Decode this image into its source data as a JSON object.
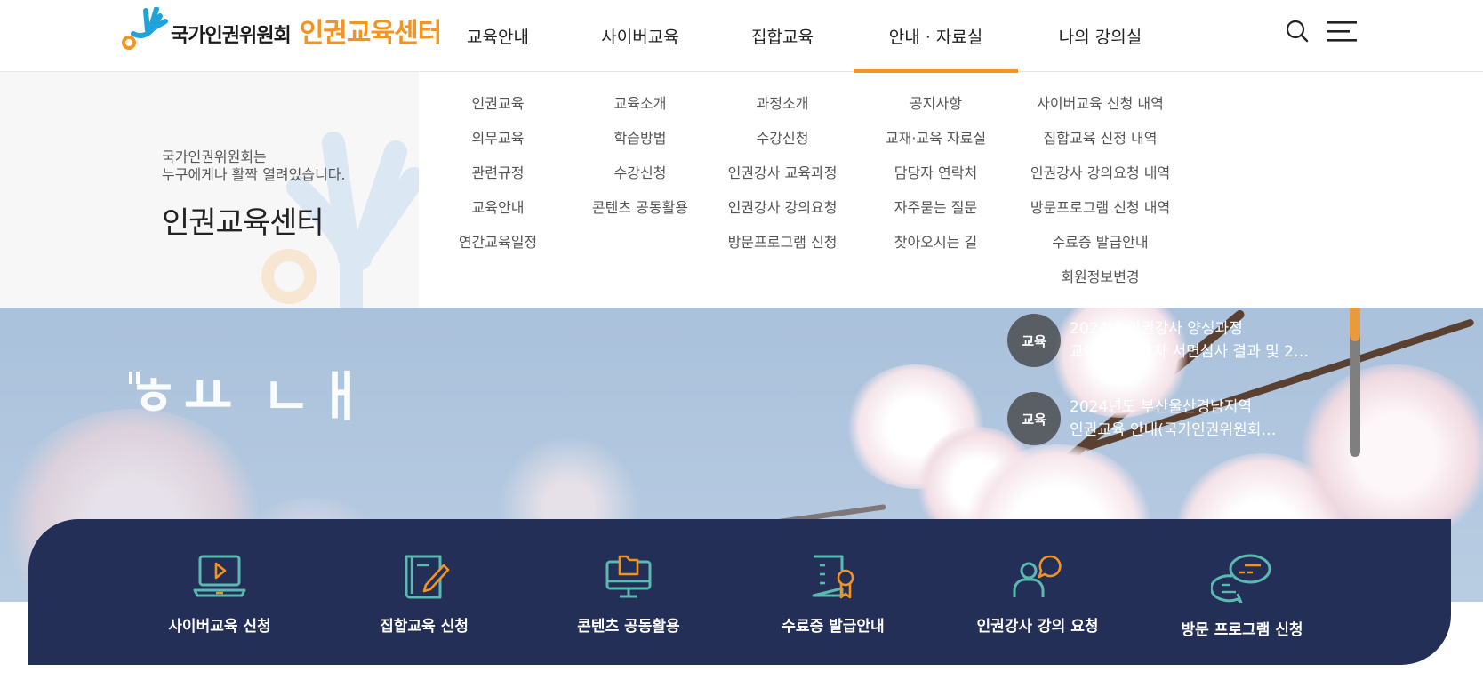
{
  "header": {
    "logo_org": "국가인권위원회",
    "logo_center": "인권교육센터",
    "nav": [
      {
        "label": "교육안내"
      },
      {
        "label": "사이버교육"
      },
      {
        "label": "집합교육"
      },
      {
        "label": "안내 · 자료실",
        "active": true
      },
      {
        "label": "나의 강의실"
      }
    ],
    "icons": {
      "search": "search-icon",
      "menu": "hamburger-menu-icon"
    }
  },
  "mega_menu": {
    "intro_line1": "국가인권위원회는",
    "intro_line2": "누구에게나 활짝 열려있습니다.",
    "intro_title": "인권교육센터",
    "columns": [
      [
        "인권교육",
        "의무교육",
        "관련규정",
        "교육안내",
        "연간교육일정"
      ],
      [
        "교육소개",
        "학습방법",
        "수강신청",
        "콘텐츠 공동활용"
      ],
      [
        "과정소개",
        "수강신청",
        "인권강사 교육과정",
        "인권강사 강의요청",
        "방문프로그램 신청"
      ],
      [
        "공지사항",
        "교재·교육 자료실",
        "담당자 연락처",
        "자주묻는 질문",
        "찾아오시는 길"
      ],
      [
        "사이버교육 신청 내역",
        "집합교육 신청 내역",
        "인권강사 강의요청 내역",
        "방문프로그램 신청 내역",
        "수료증 발급안내",
        "회원정보변경"
      ]
    ]
  },
  "hero": {
    "title_fragment": "ㅎㅛ ㄴㅐ",
    "news": [
      {
        "badge": "교육",
        "line1": "2024년 인권강사 양성과정",
        "line2": "교육생선발 1차 서면심사 결과 및 2…"
      },
      {
        "badge": "교육",
        "line1": "2024년도 부산울산경남지역",
        "line2": "인권교육 안내(국가인권위원회…"
      }
    ]
  },
  "quick_links": [
    {
      "label": "사이버교육 신청",
      "icon": "laptop-play-icon"
    },
    {
      "label": "집합교육 신청",
      "icon": "book-pen-icon"
    },
    {
      "label": "콘텐츠 공동활용",
      "icon": "monitor-folder-icon"
    },
    {
      "label": "수료증 발급안내",
      "icon": "certificate-ribbon-icon"
    },
    {
      "label": "인권강사 강의 요청",
      "icon": "person-chat-icon"
    },
    {
      "label": "방문 프로그램 신청",
      "icon": "speech-bubbles-icon"
    }
  ],
  "colors": {
    "accent": "#f39321",
    "navy": "#232f57",
    "teal": "#5bbab0"
  }
}
